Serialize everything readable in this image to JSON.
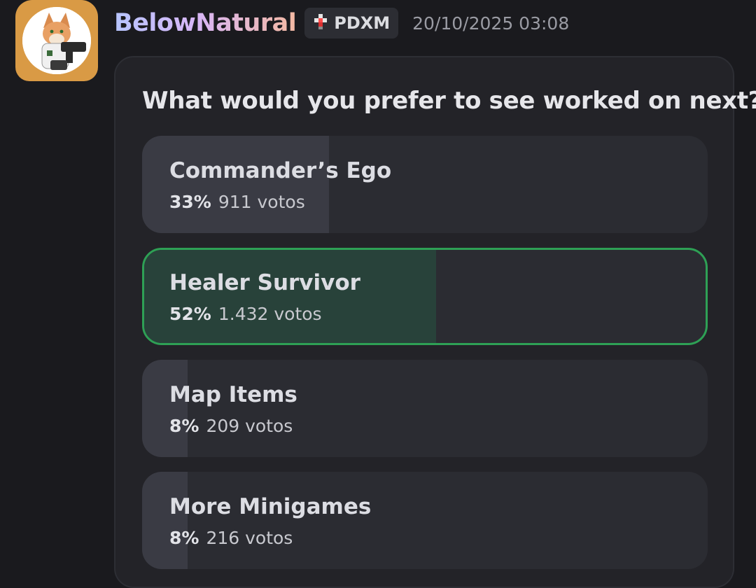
{
  "message": {
    "username": "BelowNatural",
    "tag": "PDXM",
    "tag_icon": "pixel-clan-icon",
    "timestamp": "20/10/2025 03:08",
    "avatar_icon": "fox-character-avatar"
  },
  "poll": {
    "question": "What would you prefer to see worked on next?",
    "options": [
      {
        "label": "Commander’s Ego",
        "percent_text": "33%",
        "votes_text": "911 votos",
        "percent": 33,
        "selected": false
      },
      {
        "label": "Healer Survivor",
        "percent_text": "52%",
        "votes_text": "1.432 votos",
        "percent": 52,
        "selected": true
      },
      {
        "label": "Map Items",
        "percent_text": "8%",
        "votes_text": "209 votos",
        "percent": 8,
        "selected": false
      },
      {
        "label": "More Minigames",
        "percent_text": "8%",
        "votes_text": "216 votos",
        "percent": 8,
        "selected": false
      }
    ]
  },
  "colors": {
    "background": "#1a1a1e",
    "selected_border": "#2ea055",
    "selected_fill": "#28423a"
  }
}
